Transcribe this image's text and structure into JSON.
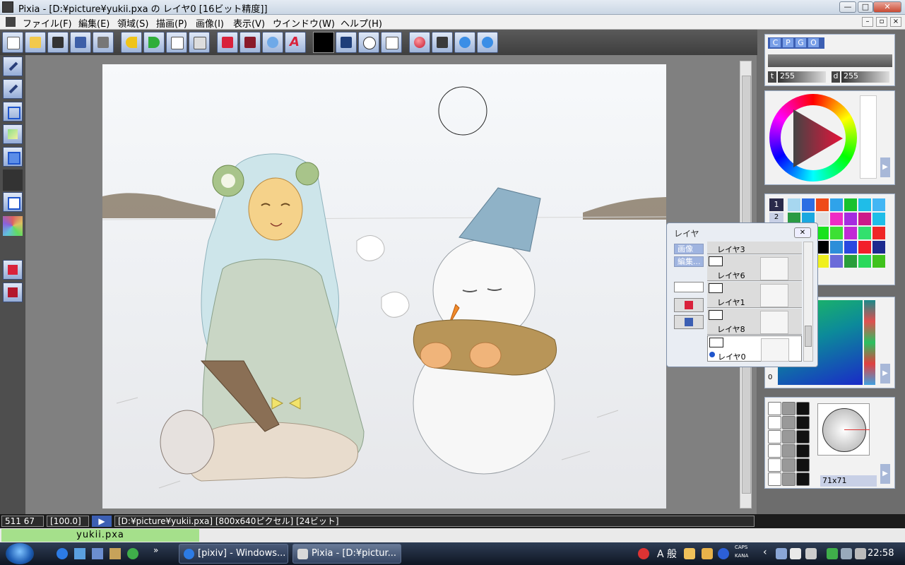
{
  "window": {
    "title": "Pixia - [D:¥picture¥yukii.pxa の レイヤ0 [16ビット精度]]",
    "min_label": "—",
    "max_label": "□",
    "close_label": "✕"
  },
  "menu": {
    "items": [
      {
        "label": "ファイル(F)"
      },
      {
        "label": "編集(E)"
      },
      {
        "label": "領域(S)"
      },
      {
        "label": "描画(P)"
      },
      {
        "label": "画像(I)"
      },
      {
        "label": "表示(V)"
      },
      {
        "label": "ウインドウ(W)"
      },
      {
        "label": "ヘルプ(H)"
      }
    ],
    "mdi": [
      "–",
      "▫",
      "×"
    ]
  },
  "toolbar": {
    "icons": [
      "new-icon",
      "open-icon",
      "camera-icon",
      "save-icon",
      "print-icon",
      "undo-icon",
      "redo-icon",
      "copy-icon",
      "paste-icon",
      "pen-icon",
      "brush-icon",
      "magnify-icon",
      "text-icon",
      "color-swatch-icon",
      "image-icon",
      "clock-icon",
      "clipboard-icon",
      "ball-icon",
      "check-icon",
      "zoom-in-icon",
      "zoom-out-icon"
    ]
  },
  "tools_panel": {
    "tabs": [
      "C",
      "P",
      "G",
      "O"
    ],
    "t_label": "t",
    "t_value": "255",
    "d_label": "d",
    "d_value": "255"
  },
  "palette": {
    "selected_index": "1",
    "second_index": "2",
    "colors": [
      "#a7d7f0",
      "#2d6ee3",
      "#ef4a19",
      "#2fa3ea",
      "#19c22f",
      "#1fbde8",
      "#43b6f4",
      "#2a9b43",
      "#1aa8e0",
      "#e0e0e0",
      "#ee2cc4",
      "#a52ce0",
      "#cd1a8a",
      "#1fbde8",
      "#f21c1c",
      "#24a55a",
      "#19e21d",
      "#3de034",
      "#c12ad6",
      "#32e06e",
      "#ef2626",
      "#2ad0ee",
      "#f5101f",
      "#000000",
      "#2d8ed9",
      "#2a48e0",
      "#f21f2a",
      "#1c2a8f",
      "#486fc0",
      "#1f9b76",
      "#f0f01f",
      "#6b6bd9",
      "#2a9e3b",
      "#2ad95c",
      "#3fc21c",
      "#f0f01f",
      "#2d8ed9"
    ]
  },
  "gradient_panel": {
    "label": "0"
  },
  "brush_panel": {
    "size_label": "71x71"
  },
  "layer_dialog": {
    "title": "レイヤ",
    "close": "✕",
    "btn_image": "画像",
    "btn_edit": "編集...",
    "layers": [
      {
        "name": "レイヤ3"
      },
      {
        "name": "レイヤ6"
      },
      {
        "name": "レイヤ1"
      },
      {
        "name": "レイヤ8"
      },
      {
        "name": "レイヤ0"
      }
    ]
  },
  "status": {
    "coords": "511 67",
    "zoom": "[100.0]",
    "info": "[D:¥picture¥yukii.pxa] [800x640ピクセル] [24ビット]"
  },
  "file_tab": {
    "name": "yukii.pxa"
  },
  "taskbar": {
    "tasks": [
      {
        "label": "[pixiv] - Windows..."
      },
      {
        "label": "Pixia - [D:¥pictur..."
      }
    ],
    "ime": "A 般",
    "caps": "CAPS",
    "kana": "KANA",
    "clock": "22:58"
  },
  "colors": {
    "accent": "#3c5fb3",
    "status_bg": "#1c1c1c",
    "file_tab": "#a5e08b"
  }
}
